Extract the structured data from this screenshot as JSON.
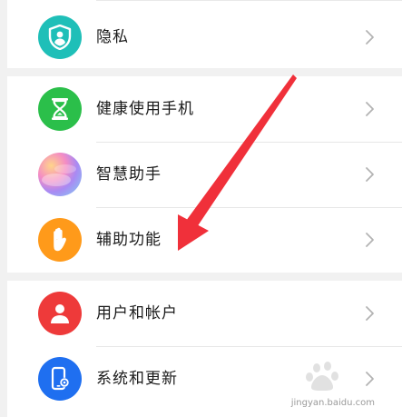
{
  "settings": {
    "items": [
      {
        "label": "隐私",
        "icon": "shield-person-icon",
        "color": "#1fbfb8"
      },
      {
        "label": "健康使用手机",
        "icon": "hourglass-icon",
        "color": "#2bbf4a"
      },
      {
        "label": "智慧助手",
        "icon": "gradient-orb-icon",
        "color": "#d58bd0"
      },
      {
        "label": "辅助功能",
        "icon": "hand-icon",
        "color": "#ff9a1a"
      },
      {
        "label": "用户和帐户",
        "icon": "person-icon",
        "color": "#ee3a3a"
      },
      {
        "label": "系统和更新",
        "icon": "phone-gear-icon",
        "color": "#1f6ff0"
      }
    ]
  },
  "watermark": {
    "text": "jingyan.baidu.com",
    "icon": "baidu-paw-icon"
  },
  "annotation": {
    "color": "#f0303a",
    "icon": "red-arrow"
  }
}
